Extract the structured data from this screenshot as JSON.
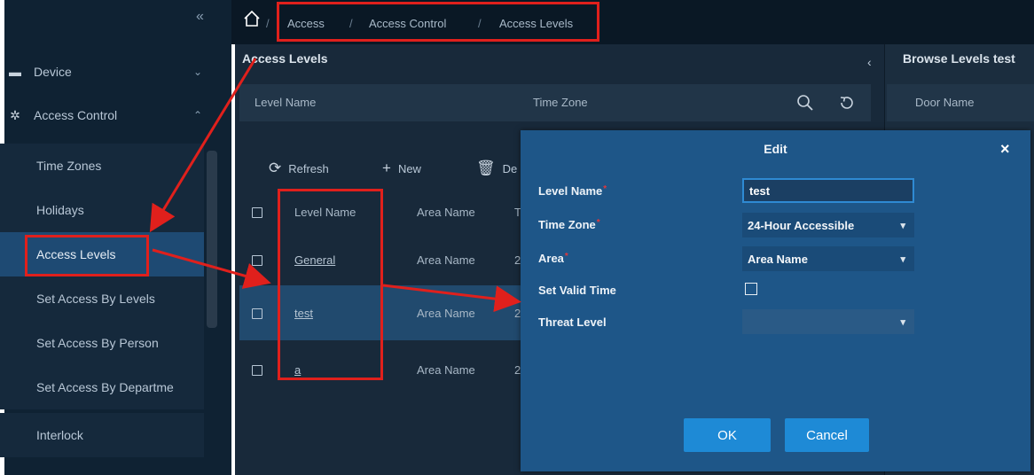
{
  "sidebar": {
    "collapse_icon": "double-chevron-left",
    "groups": [
      {
        "label": "Device",
        "icon": "device-icon",
        "state": "collapsed"
      },
      {
        "label": "Access Control",
        "icon": "gear-icon",
        "state": "expanded"
      }
    ],
    "items": [
      {
        "label": "Time Zones"
      },
      {
        "label": "Holidays"
      },
      {
        "label": "Access Levels",
        "active": true
      },
      {
        "label": "Set Access By Levels"
      },
      {
        "label": "Set Access By Person"
      },
      {
        "label": "Set Access By Departme"
      },
      {
        "label": "Interlock"
      }
    ]
  },
  "breadcrumb": {
    "sep": "/",
    "items": [
      "Access",
      "Access Control",
      "Access Levels"
    ]
  },
  "main": {
    "title": "Access Levels",
    "filter": {
      "level_name_label": "Level Name",
      "time_zone_label": "Time Zone"
    },
    "toolbar": {
      "refresh": "Refresh",
      "new": "New",
      "delete_partial": "De"
    },
    "table": {
      "headers": [
        "Level Name",
        "Area Name",
        "T"
      ],
      "rows": [
        {
          "level_name": "General",
          "area_name": "Area Name",
          "time_zone_partial": "2"
        },
        {
          "level_name": "test",
          "area_name": "Area Name",
          "time_zone_partial": "2",
          "selected": true
        },
        {
          "level_name": "a",
          "area_name": "Area Name",
          "time_zone_partial": "2"
        }
      ]
    }
  },
  "right_panel": {
    "title": "Browse Levels test",
    "door_name_label": "Door Name"
  },
  "dialog": {
    "title": "Edit",
    "close": "×",
    "required_mark": "*",
    "fields": {
      "level_name": {
        "label": "Level Name",
        "value": "test"
      },
      "time_zone": {
        "label": "Time Zone",
        "value": "24-Hour Accessible"
      },
      "area": {
        "label": "Area",
        "value": "Area Name"
      },
      "set_valid_time": {
        "label": "Set Valid Time",
        "checked": false
      },
      "threat_level": {
        "label": "Threat Level",
        "value": ""
      }
    },
    "ok": "OK",
    "cancel": "Cancel"
  },
  "colors": {
    "annotation_red": "#e0201c",
    "dialog_bg": "#1e5688",
    "button_blue": "#1e8ad6",
    "sidebar_active": "#1e4a73"
  }
}
